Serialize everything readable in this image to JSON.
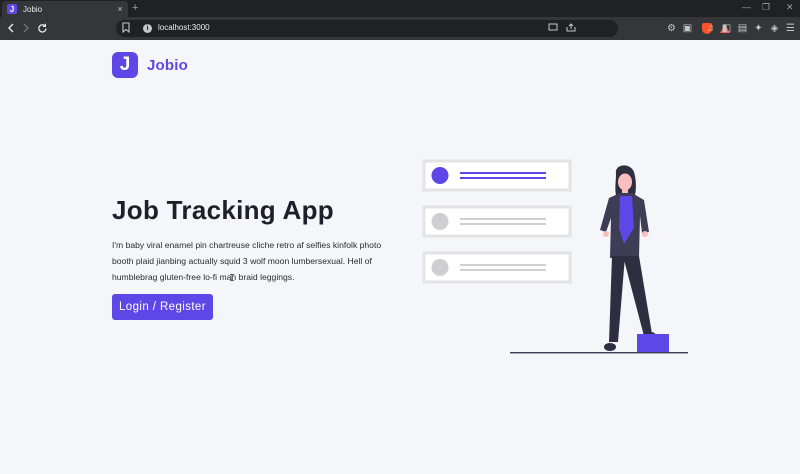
{
  "browser": {
    "tab_title": "Jobio",
    "tab_favicon_letter": "J",
    "tab_close": "×",
    "new_tab": "+",
    "url": "localhost:3000",
    "window_controls": [
      "—",
      "❐",
      "✕"
    ]
  },
  "brand": {
    "name": "Jobio",
    "logo_letter": "J",
    "accent_color": "#5d47e6"
  },
  "hero": {
    "title": "Job Tracking App",
    "description": "I'm baby viral enamel pin chartreuse cliche retro af selfies kinfolk photo booth plaid jianbing actually squid 3 wolf moon lumbersexual. Hell of humblebrag gluten-free lo-fi man braid leggings.",
    "cta_label": "Login / Register"
  },
  "illustration": {
    "cards": [
      {
        "active": true
      },
      {
        "active": false
      },
      {
        "active": false
      }
    ]
  }
}
